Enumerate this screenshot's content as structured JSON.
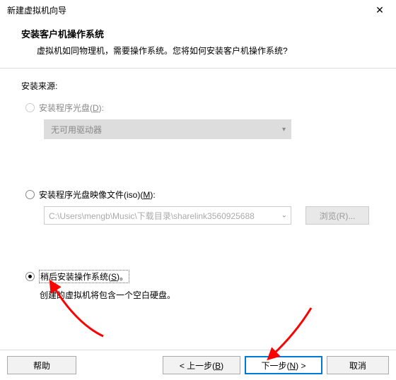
{
  "titlebar": {
    "title": "新建虚拟机向导"
  },
  "header": {
    "title": "安装客户机操作系统",
    "subtitle": "虚拟机如同物理机，需要操作系统。您将如何安装客户机操作系统?"
  },
  "source_label": "安装来源:",
  "option_disc": {
    "label_pre": "安装程序光盘(",
    "hotkey": "D",
    "label_post": "):",
    "dropdown_text": "无可用驱动器"
  },
  "option_iso": {
    "label_pre": "安装程序光盘映像文件(iso)(",
    "hotkey": "M",
    "label_post": "):",
    "path_value": "C:\\Users\\mengb\\Music\\下载目录\\sharelink3560925688",
    "browse_pre": "浏览(",
    "browse_hot": "R",
    "browse_post": ")..."
  },
  "option_later": {
    "label_pre": "稍后安装操作系统(",
    "hotkey": "S",
    "label_post": ")。",
    "hint": "创建的虚拟机将包含一个空白硬盘。"
  },
  "footer": {
    "help": "帮助",
    "back_pre": "< 上一步(",
    "back_hot": "B",
    "back_post": ")",
    "next_pre": "下一步(",
    "next_hot": "N",
    "next_post": ") >",
    "cancel": "取消"
  }
}
